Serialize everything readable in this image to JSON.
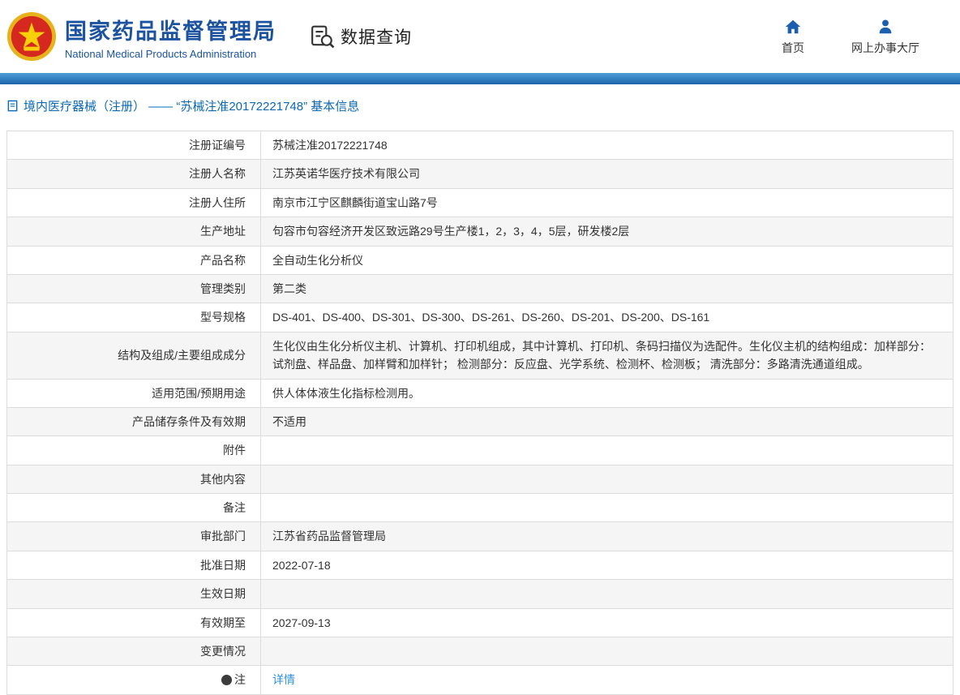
{
  "header": {
    "org_name_cn": "国家药品监督管理局",
    "org_name_en": "National Medical Products Administration",
    "section_title": "数据查询",
    "nav": [
      {
        "icon": "home-icon",
        "label": "首页"
      },
      {
        "icon": "person-icon",
        "label": "网上办事大厅"
      }
    ]
  },
  "breadcrumb": {
    "text": "境内医疗器械（注册） —— “苏械注准20172221748” 基本信息"
  },
  "colors": {
    "brand_blue": "#1b53a0",
    "bar_blue": "#1d64ab",
    "link_blue": "#2e8fd8",
    "stripe_gray": "#f5f5f5"
  },
  "table": {
    "rows": [
      {
        "label": "注册证编号",
        "value": "苏械注准20172221748"
      },
      {
        "label": "注册人名称",
        "value": "江苏英诺华医疗技术有限公司"
      },
      {
        "label": "注册人住所",
        "value": "南京市江宁区麒麟街道宝山路7号"
      },
      {
        "label": "生产地址",
        "value": "句容市句容经济开发区致远路29号生产楼1，2，3，4，5层，研发楼2层"
      },
      {
        "label": "产品名称",
        "value": "全自动生化分析仪"
      },
      {
        "label": "管理类别",
        "value": "第二类"
      },
      {
        "label": "型号规格",
        "value": "DS-401、DS-400、DS-301、DS-300、DS-261、DS-260、DS-201、DS-200、DS-161"
      },
      {
        "label": "结构及组成/主要组成成分",
        "value": "生化仪由生化分析仪主机、计算机、打印机组成，其中计算机、打印机、条码扫描仪为选配件。生化仪主机的结构组成：加样部分：试剂盘、样品盘、加样臂和加样针； 检测部分：反应盘、光学系统、检测杯、检测板； 清洗部分：多路清洗通道组成。"
      },
      {
        "label": "适用范围/预期用途",
        "value": "供人体体液生化指标检测用。"
      },
      {
        "label": "产品储存条件及有效期",
        "value": "不适用"
      },
      {
        "label": "附件",
        "value": ""
      },
      {
        "label": "其他内容",
        "value": ""
      },
      {
        "label": "备注",
        "value": ""
      },
      {
        "label": "审批部门",
        "value": "江苏省药品监督管理局"
      },
      {
        "label": "批准日期",
        "value": "2022-07-18"
      },
      {
        "label": "生效日期",
        "value": ""
      },
      {
        "label": "有效期至",
        "value": "2027-09-13"
      },
      {
        "label": "变更情况",
        "value": ""
      },
      {
        "label": "注",
        "value": "详情",
        "link": true,
        "label_icon": "note-icon"
      }
    ]
  }
}
